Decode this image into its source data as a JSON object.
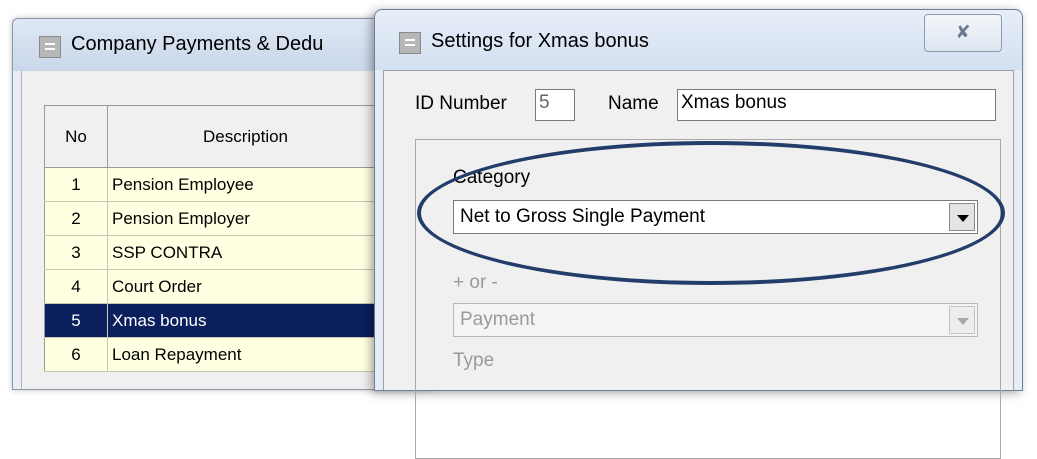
{
  "background_window": {
    "title": "Company Payments & Dedu",
    "table": {
      "columns": [
        "No",
        "Description"
      ],
      "rows": [
        {
          "no": "1",
          "description": "Pension Employee"
        },
        {
          "no": "2",
          "description": "Pension Employer"
        },
        {
          "no": "3",
          "description": "SSP CONTRA"
        },
        {
          "no": "4",
          "description": "Court Order"
        },
        {
          "no": "5",
          "description": "Xmas bonus"
        },
        {
          "no": "6",
          "description": "Loan Repayment"
        }
      ],
      "selected_no": "5"
    }
  },
  "dialog": {
    "title": "Settings for Xmas bonus",
    "close_glyph": "✘",
    "id_label": "ID Number",
    "id_value": "5",
    "name_label": "Name",
    "name_value": "Xmas bonus",
    "category_label": "Category",
    "category_value": "Net to Gross Single Payment",
    "sign_label": "+ or -",
    "sign_value": "Payment",
    "type_label": "Type"
  },
  "colors": {
    "selection": "#0a1f5c",
    "row_background": "#ffffe1",
    "annotation_ellipse": "#233d6b"
  }
}
